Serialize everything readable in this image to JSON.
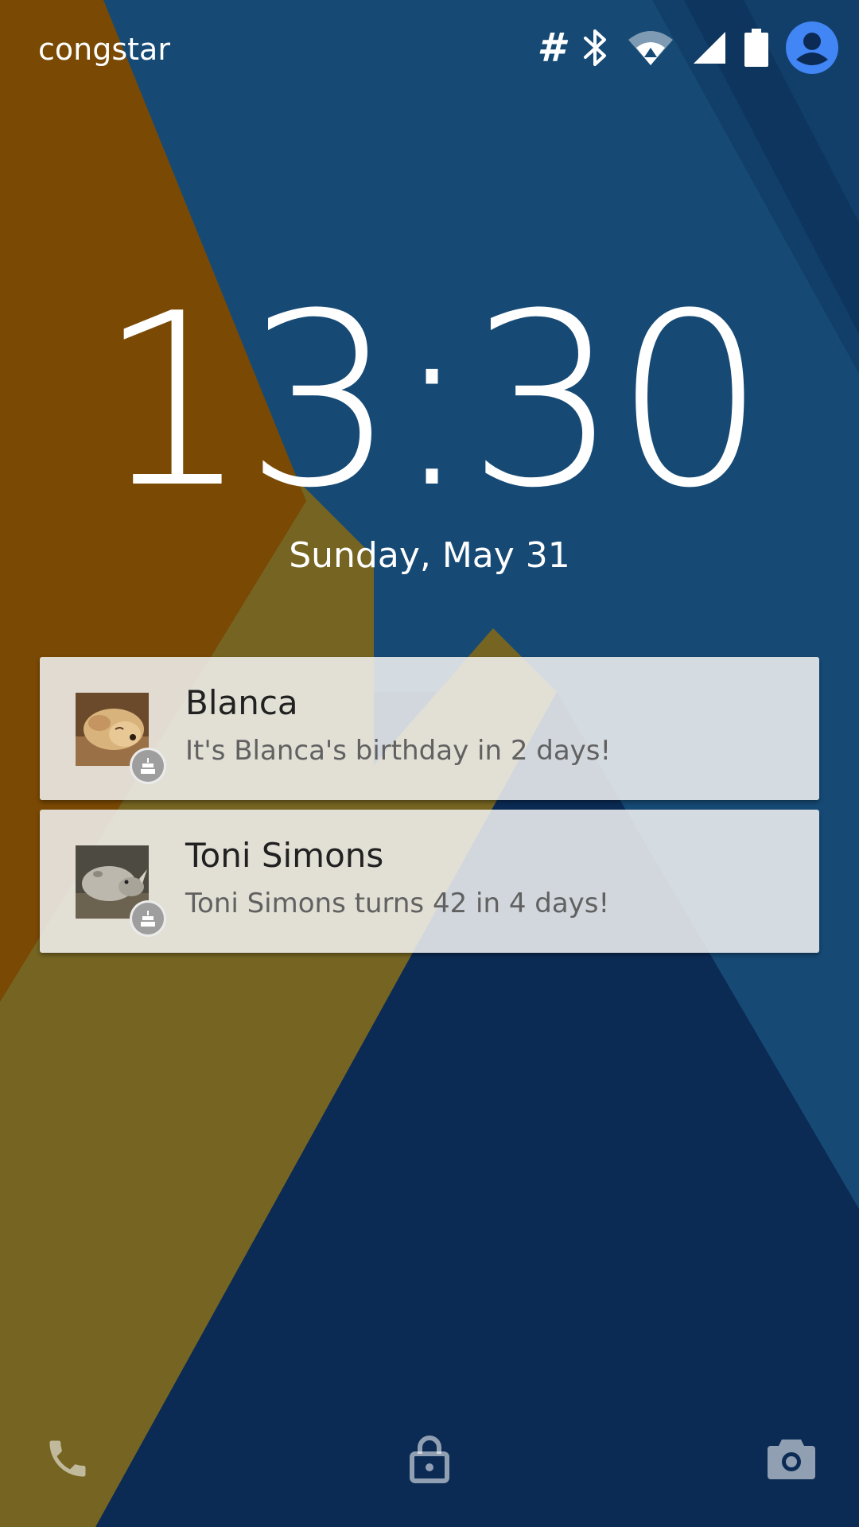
{
  "status_bar": {
    "carrier": "congstar",
    "icons": [
      "hashtag-icon",
      "bluetooth-icon",
      "wifi-icon",
      "cell-signal-icon",
      "battery-icon",
      "user-avatar-icon"
    ],
    "accent_color": "#4285f4"
  },
  "lockscreen": {
    "time": "13:30",
    "date": "Sunday, May 31"
  },
  "notifications": [
    {
      "title": "Blanca",
      "text": "It's Blanca's birthday in 2 days!",
      "avatar": "dog-photo",
      "badge": "birthday-cake-icon"
    },
    {
      "title": "Toni Simons",
      "text": "Toni Simons turns 42 in 4 days!",
      "avatar": "rhino-photo",
      "badge": "birthday-cake-icon"
    }
  ],
  "bottom_bar": {
    "left": "phone-icon",
    "center": "lock-icon",
    "right": "camera-icon"
  },
  "colors": {
    "wallpaper_blue": "#164a75",
    "wallpaper_navy": "#0b2b55",
    "wallpaper_orange": "#7a4904",
    "wallpaper_olive": "#756522",
    "notification_bg": "#f3f3f3"
  }
}
